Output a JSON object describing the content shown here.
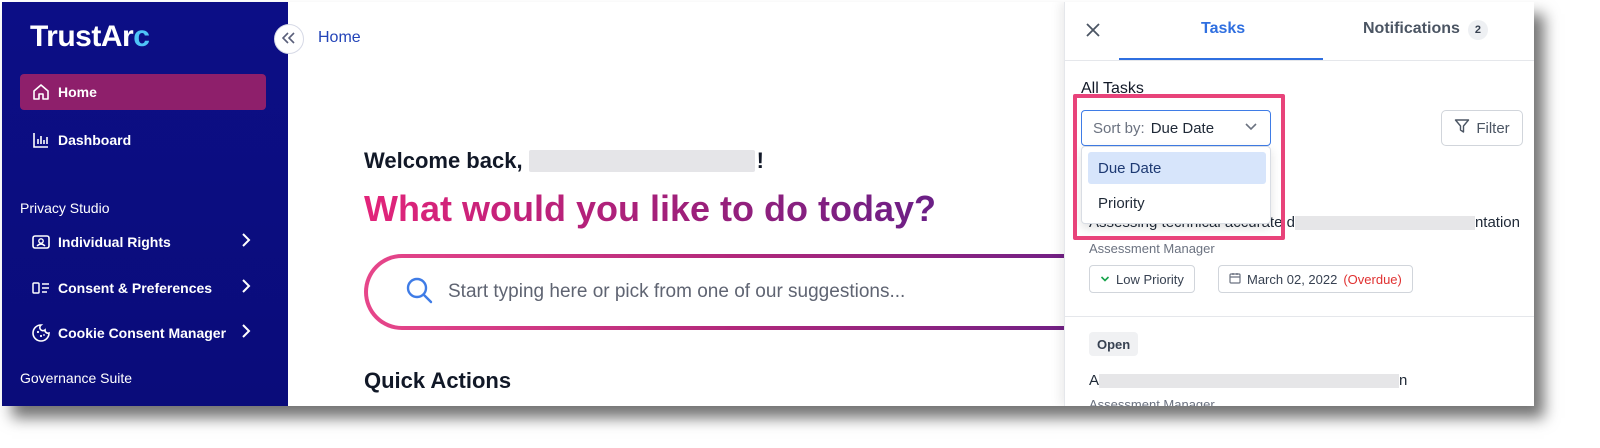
{
  "sidebar": {
    "logo_main": "TrustAr",
    "logo_accent": "c",
    "items": [
      {
        "label": "Home"
      },
      {
        "label": "Dashboard"
      },
      {
        "label": "Individual Rights"
      },
      {
        "label": "Consent & Preferences"
      },
      {
        "label": "Cookie Consent Manager"
      }
    ],
    "sections": [
      "Privacy Studio",
      "Governance Suite"
    ]
  },
  "breadcrumb": "Home",
  "main": {
    "welcome_prefix": "Welcome back,",
    "welcome_suffix": "!",
    "headline": "What would you like to do today?",
    "search_placeholder": "Start typing here or pick from one of our suggestions...",
    "quick_actions": "Quick Actions"
  },
  "panel": {
    "tabs": [
      {
        "label": "Tasks"
      },
      {
        "label": "Notifications",
        "badge": "2"
      }
    ],
    "all_tasks_label": "All Tasks",
    "sort": {
      "label": "Sort by:",
      "value": "Due Date",
      "options": [
        "Due Date",
        "Priority"
      ]
    },
    "filter_label": "Filter",
    "tasks": [
      {
        "title_start": "Assessing technical accurate d",
        "title_end": "ntation",
        "role": "Assessment Manager",
        "priority": "Low Priority",
        "due": "March 02, 2022",
        "overdue": "(Overdue)"
      },
      {
        "status": "Open",
        "title_start": "A",
        "title_end": "n",
        "role": "Assessment Manager"
      }
    ]
  },
  "colors": {
    "sidebar_bg": "#0c0e86",
    "active_item": "#8e1f6b",
    "accent_blue": "#2f6fe0",
    "highlight": "#e8437a",
    "overdue": "#e03131"
  }
}
